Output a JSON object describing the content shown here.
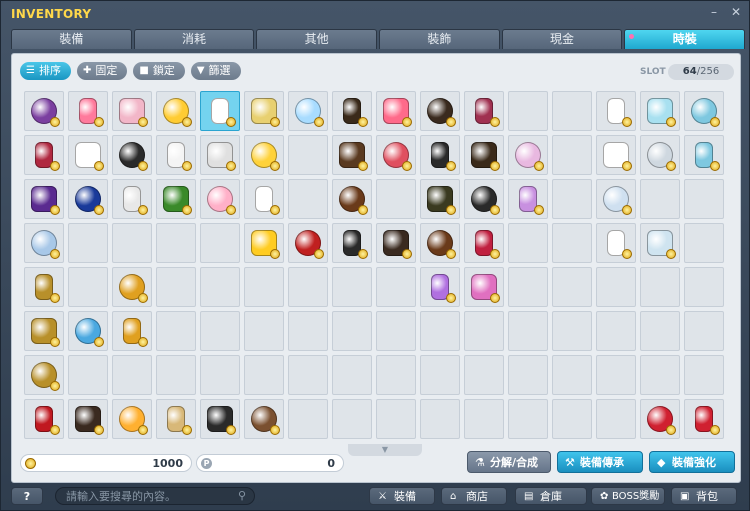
{
  "window": {
    "title": "INVENTORY",
    "minimize": "–",
    "close": "✕"
  },
  "tabs": [
    {
      "label": "裝備",
      "active": false
    },
    {
      "label": "消耗",
      "active": false
    },
    {
      "label": "其他",
      "active": false
    },
    {
      "label": "裝飾",
      "active": false
    },
    {
      "label": "現金",
      "active": false
    },
    {
      "label": "時裝",
      "active": true
    }
  ],
  "toolbar": {
    "sort": "排序",
    "fix": "固定",
    "lock": "鎖定",
    "filter": "篩選"
  },
  "slot": {
    "label": "SLOT",
    "used": "64",
    "total": "/256"
  },
  "grid": {
    "rows": 8,
    "cols": 16,
    "selected_cell": [
      0,
      4
    ],
    "items": [
      [
        0,
        0,
        "#7b3fa0"
      ],
      [
        0,
        1,
        "#ff7a9c"
      ],
      [
        0,
        2,
        "#f2b6c8"
      ],
      [
        0,
        3,
        "#ffcc33"
      ],
      [
        0,
        4,
        "#ffffff"
      ],
      [
        0,
        5,
        "#e8d070"
      ],
      [
        0,
        6,
        "#a8dcff"
      ],
      [
        0,
        7,
        "#3a2a1a"
      ],
      [
        0,
        8,
        "#ff6a8a"
      ],
      [
        0,
        9,
        "#3a2a1e"
      ],
      [
        0,
        10,
        "#a03050"
      ],
      [
        0,
        13,
        "#ffffff"
      ],
      [
        0,
        14,
        "#a8e0f0"
      ],
      [
        0,
        15,
        "#7ec8e0"
      ],
      [
        1,
        0,
        "#b02840"
      ],
      [
        1,
        1,
        "#ffffff"
      ],
      [
        1,
        2,
        "#2a2a2a"
      ],
      [
        1,
        3,
        "#f4f4f4"
      ],
      [
        1,
        4,
        "#e0e0e0"
      ],
      [
        1,
        5,
        "#ffd23a"
      ],
      [
        1,
        7,
        "#5a3a20"
      ],
      [
        1,
        8,
        "#e05060"
      ],
      [
        1,
        9,
        "#2a2a2a"
      ],
      [
        1,
        10,
        "#3a2a1a"
      ],
      [
        1,
        11,
        "#e8b8e0"
      ],
      [
        1,
        13,
        "#ffffff"
      ],
      [
        1,
        14,
        "#cfd8e0"
      ],
      [
        1,
        15,
        "#7ec8e0"
      ],
      [
        2,
        0,
        "#5a2a90"
      ],
      [
        2,
        1,
        "#1a3a9a"
      ],
      [
        2,
        2,
        "#e8e8e8"
      ],
      [
        2,
        3,
        "#3a8a2a"
      ],
      [
        2,
        4,
        "#ffb0c8"
      ],
      [
        2,
        5,
        "#ffffff"
      ],
      [
        2,
        7,
        "#6a3a1a"
      ],
      [
        2,
        9,
        "#3a3a20"
      ],
      [
        2,
        10,
        "#2a2a2a"
      ],
      [
        2,
        11,
        "#c890e0"
      ],
      [
        2,
        13,
        "#cfe0f0"
      ],
      [
        3,
        0,
        "#a8c8e8"
      ],
      [
        3,
        5,
        "#ffcc22"
      ],
      [
        3,
        6,
        "#c02020"
      ],
      [
        3,
        7,
        "#2a2a2a"
      ],
      [
        3,
        8,
        "#3a2a20"
      ],
      [
        3,
        9,
        "#6a3a1a"
      ],
      [
        3,
        10,
        "#c02040"
      ],
      [
        3,
        13,
        "#ffffff"
      ],
      [
        3,
        14,
        "#cfe4f0"
      ],
      [
        4,
        0,
        "#b8902a"
      ],
      [
        4,
        2,
        "#e0a020"
      ],
      [
        4,
        9,
        "#b070e0"
      ],
      [
        4,
        10,
        "#e070c0"
      ],
      [
        5,
        0,
        "#b8902a"
      ],
      [
        5,
        1,
        "#4aa8e0"
      ],
      [
        5,
        2,
        "#e0a020"
      ],
      [
        6,
        0,
        "#b8902a"
      ],
      [
        7,
        0,
        "#c01820"
      ],
      [
        7,
        1,
        "#3a2a20"
      ],
      [
        7,
        2,
        "#ffb030"
      ],
      [
        7,
        3,
        "#d8b878"
      ],
      [
        7,
        4,
        "#2a2a2a"
      ],
      [
        7,
        5,
        "#7a5030"
      ],
      [
        7,
        14,
        "#d02030"
      ],
      [
        7,
        15,
        "#d02030"
      ]
    ]
  },
  "scroll_down_icon": "chevron-down",
  "currency": {
    "meso": "1000",
    "points": "0",
    "point_icon_letter": "P"
  },
  "actions": {
    "combine": "分解/合成",
    "transfer": "裝備傳承",
    "enhance": "裝備強化"
  },
  "bottom": {
    "help": "?",
    "search_placeholder": "請輸入要搜尋的內容。",
    "equip": "裝備",
    "shop": "商店",
    "storage": "倉庫",
    "boss": "BOSS獎勵",
    "bag": "背包"
  }
}
